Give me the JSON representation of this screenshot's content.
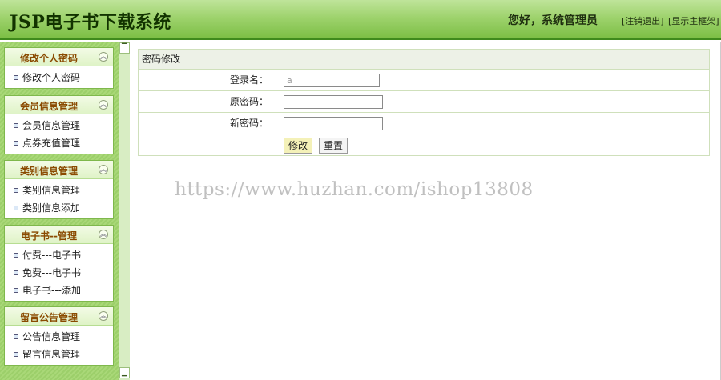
{
  "header": {
    "title": "JSP电子书下载系统",
    "greeting": "您好，系统管理员",
    "logout_link": "[注销退出]",
    "frame_link": "[显示主框架]"
  },
  "sidebar": {
    "groups": [
      {
        "title": "修改个人密码",
        "items": [
          "修改个人密码"
        ]
      },
      {
        "title": "会员信息管理",
        "items": [
          "会员信息管理",
          "点券充值管理"
        ]
      },
      {
        "title": "类别信息管理",
        "items": [
          "类别信息管理",
          "类别信息添加"
        ]
      },
      {
        "title": "电子书--管理",
        "items": [
          "付费---电子书",
          "免费---电子书",
          "电子书---添加"
        ]
      },
      {
        "title": "留言公告管理",
        "items": [
          "公告信息管理",
          "留言信息管理"
        ]
      }
    ]
  },
  "form": {
    "title": "密码修改",
    "login_label": "登录名：",
    "login_value": "a",
    "old_pwd_label": "原密码：",
    "new_pwd_label": "新密码：",
    "submit_label": "修改",
    "reset_label": "重置"
  },
  "watermark": "https://www.huzhan.com/ishop13808"
}
